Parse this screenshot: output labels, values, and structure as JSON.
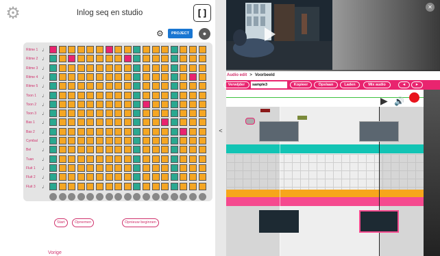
{
  "header": {
    "title": "Inlog seq en studio",
    "bracket_label": "[ ]",
    "project_label": "PROJECT"
  },
  "grid": {
    "rows": [
      {
        "label": "Ritme 1",
        "cells": [
          "p",
          "o",
          "o",
          "o",
          "o",
          "o",
          "p",
          "o",
          "o",
          "t",
          "o",
          "o",
          "o",
          "t",
          "o",
          "o",
          "o"
        ]
      },
      {
        "label": "Ritme 2",
        "cells": [
          "t",
          "o",
          "p",
          "o",
          "o",
          "o",
          "o",
          "o",
          "p",
          "t",
          "o",
          "o",
          "o",
          "t",
          "o",
          "o",
          "o"
        ]
      },
      {
        "label": "Ritme 3",
        "cells": [
          "t",
          "o",
          "o",
          "o",
          "o",
          "o",
          "o",
          "o",
          "o",
          "t",
          "o",
          "o",
          "o",
          "t",
          "o",
          "o",
          "o"
        ]
      },
      {
        "label": "Ritme 4",
        "cells": [
          "t",
          "o",
          "o",
          "o",
          "o",
          "o",
          "o",
          "o",
          "o",
          "t",
          "o",
          "o",
          "o",
          "t",
          "o",
          "p",
          "o"
        ]
      },
      {
        "label": "Ritme 5",
        "cells": [
          "t",
          "o",
          "o",
          "o",
          "o",
          "o",
          "o",
          "o",
          "o",
          "t",
          "o",
          "o",
          "o",
          "t",
          "o",
          "o",
          "o"
        ]
      },
      {
        "label": "Toon 1",
        "cells": [
          "t",
          "o",
          "o",
          "o",
          "o",
          "o",
          "o",
          "o",
          "o",
          "t",
          "o",
          "o",
          "o",
          "t",
          "o",
          "o",
          "o"
        ]
      },
      {
        "label": "Toon 2",
        "cells": [
          "t",
          "o",
          "o",
          "o",
          "o",
          "o",
          "o",
          "o",
          "o",
          "t",
          "p",
          "o",
          "o",
          "t",
          "o",
          "o",
          "o"
        ]
      },
      {
        "label": "Toon 3",
        "cells": [
          "t",
          "o",
          "o",
          "o",
          "o",
          "o",
          "o",
          "o",
          "o",
          "t",
          "o",
          "o",
          "o",
          "t",
          "o",
          "o",
          "o"
        ]
      },
      {
        "label": "Bas 1",
        "cells": [
          "t",
          "o",
          "o",
          "o",
          "o",
          "o",
          "o",
          "o",
          "o",
          "t",
          "o",
          "o",
          "p",
          "t",
          "o",
          "o",
          "o"
        ]
      },
      {
        "label": "Bas 2",
        "cells": [
          "t",
          "o",
          "o",
          "o",
          "o",
          "o",
          "o",
          "o",
          "o",
          "t",
          "o",
          "o",
          "o",
          "t",
          "p",
          "o",
          "o"
        ]
      },
      {
        "label": "Cymbal",
        "cells": [
          "t",
          "o",
          "o",
          "o",
          "o",
          "o",
          "o",
          "o",
          "o",
          "t",
          "o",
          "o",
          "o",
          "t",
          "o",
          "o",
          "o"
        ]
      },
      {
        "label": "Bel",
        "cells": [
          "t",
          "o",
          "o",
          "o",
          "o",
          "o",
          "o",
          "o",
          "o",
          "t",
          "o",
          "o",
          "o",
          "t",
          "o",
          "o",
          "o"
        ]
      },
      {
        "label": "Tuan",
        "cells": [
          "t",
          "o",
          "o",
          "o",
          "o",
          "o",
          "o",
          "o",
          "o",
          "t",
          "o",
          "o",
          "o",
          "t",
          "o",
          "o",
          "o"
        ]
      },
      {
        "label": "Fluit 1",
        "cells": [
          "t",
          "o",
          "o",
          "o",
          "o",
          "o",
          "o",
          "o",
          "o",
          "t",
          "o",
          "o",
          "o",
          "t",
          "o",
          "o",
          "o"
        ]
      },
      {
        "label": "Fluit 2",
        "cells": [
          "t",
          "o",
          "o",
          "o",
          "o",
          "o",
          "o",
          "o",
          "o",
          "t",
          "o",
          "o",
          "o",
          "t",
          "o",
          "o",
          "o"
        ]
      },
      {
        "label": "Fluit 3",
        "cells": [
          "t",
          "o",
          "o",
          "o",
          "o",
          "o",
          "o",
          "o",
          "o",
          "t",
          "o",
          "o",
          "o",
          "t",
          "o",
          "o",
          "o"
        ]
      }
    ],
    "ball_count": 17
  },
  "controls": {
    "start": "Start",
    "record": "Opnemen",
    "restart": "Opnieuw beginnen",
    "previous": "Vorige"
  },
  "studio": {
    "breadcrumb_a": "Audio edit",
    "breadcrumb_sep": ">",
    "breadcrumb_b": "Voorbeeld",
    "remove": "Verwijder",
    "sample_value": "sample3",
    "copy": "Kopieer",
    "save": "Opslaan",
    "load": "Laden",
    "mix": "Mix audio",
    "prev_arrow": "◄",
    "next_arrow": "►"
  },
  "colors": {
    "orange": "#f5a623",
    "teal": "#2aa890",
    "pink": "#e9246f",
    "accent_blue": "#1976d2"
  }
}
